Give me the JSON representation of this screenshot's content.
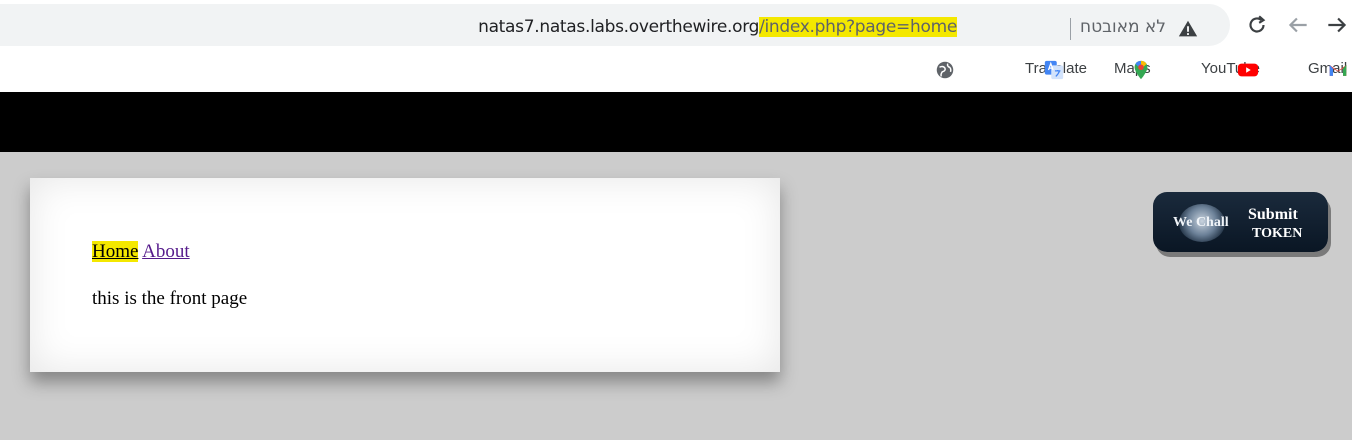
{
  "browser": {
    "url_host": "natas7.natas.labs.overthewire.org",
    "url_path": "/index.php?page=home",
    "security_label": "לא מאובטח",
    "bookmarks": [
      {
        "label": "Translate",
        "icon": "google-translate-icon"
      },
      {
        "label": "Maps",
        "icon": "google-maps-icon"
      },
      {
        "label": "YouTube",
        "icon": "youtube-icon"
      },
      {
        "label": "Gmail",
        "icon": "gmail-icon"
      }
    ]
  },
  "page": {
    "nav": {
      "home": "Home",
      "about": "About"
    },
    "body_text": "this is the front page"
  },
  "token_button": {
    "logo_text": "We Chall",
    "line1": "Submit",
    "line2": "TOKEN"
  },
  "colors": {
    "highlight": "#f4e800",
    "page_bg": "#cccccc",
    "header_bar": "#000000"
  }
}
